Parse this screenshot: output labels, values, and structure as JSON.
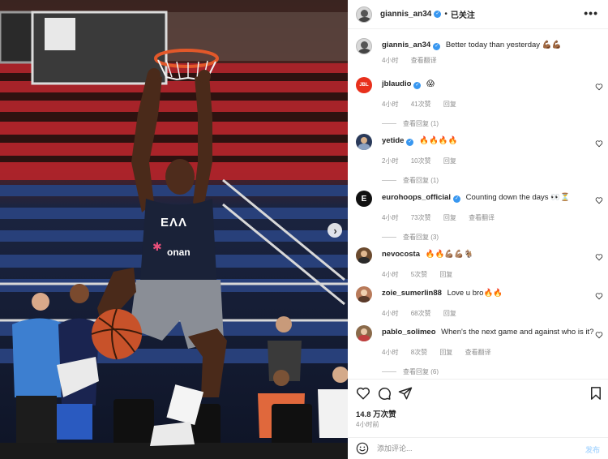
{
  "post": {
    "author": "giannis_an34",
    "separator": "•",
    "follow_status": "已关注",
    "more_glyph": "•••",
    "caption": {
      "username": "giannis_an34",
      "text": "Better today than yesterday 💪🏾💪🏾",
      "time": "4小时",
      "translate": "查看翻译"
    },
    "likes": "14.8 万次赞",
    "time_ago": "4小时前"
  },
  "photo": {
    "jersey_text": "ΕΛΛ",
    "sponsor_text": "onan",
    "next_glyph": "›"
  },
  "comments": [
    {
      "username": "jblaudio",
      "verified": true,
      "text": "😱",
      "time": "4小时",
      "likes": "41次赞",
      "reply": "回复",
      "replies": "查看回复 (1)",
      "avatar_color": "#e8301c",
      "avatar_text": "JBL"
    },
    {
      "username": "yetide",
      "verified": true,
      "text": "🔥🔥🔥🔥",
      "time": "2小时",
      "likes": "10次赞",
      "reply": "回复",
      "replies": "查看回复 (1)",
      "avatar_color": "#2a3a5a",
      "avatar_text": ""
    },
    {
      "username": "eurohoops_official",
      "verified": true,
      "text": "Counting down the days 👀⏳",
      "time": "4小时",
      "likes": "73次赞",
      "reply": "回复",
      "translate": "查看翻译",
      "replies": "查看回复 (3)",
      "avatar_color": "#111111",
      "avatar_text": "E"
    },
    {
      "username": "nevocosta",
      "verified": false,
      "text": "🔥🔥💪🏽💪🏽🐐",
      "time": "4小时",
      "likes": "5次赞",
      "reply": "回复",
      "avatar_color": "#6b4a2e",
      "avatar_text": ""
    },
    {
      "username": "zoie_sumerlin88",
      "verified": false,
      "text": "Love u bro🔥🔥",
      "time": "4小时",
      "likes": "68次赞",
      "reply": "回复",
      "avatar_color": "#b87a5a",
      "avatar_text": ""
    },
    {
      "username": "pablo_solimeo",
      "verified": false,
      "text": "When's the next game and against who is it?",
      "time": "4小时",
      "likes": "8次赞",
      "reply": "回复",
      "translate": "查看翻译",
      "replies": "查看回复 (6)",
      "avatar_color": "#8a6a4a",
      "avatar_text": ""
    }
  ],
  "composer": {
    "placeholder": "添加评论...",
    "post_label": "发布"
  },
  "colors": {
    "verified": "#3897f0",
    "muted": "#8e8e8e",
    "post_disabled": "#b3dbff"
  }
}
